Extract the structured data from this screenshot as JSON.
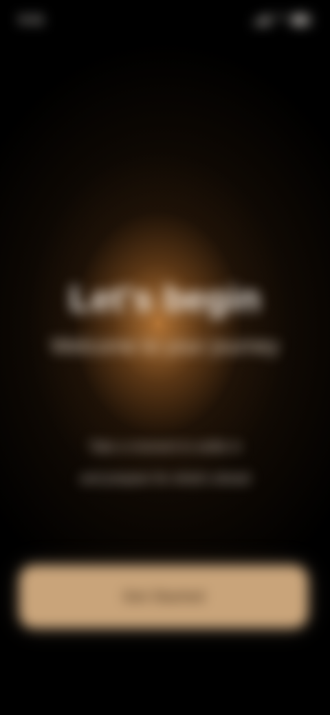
{
  "status_bar": {
    "time": "9:41",
    "icons": [
      "signal-icon",
      "wifi-icon",
      "battery-icon"
    ]
  },
  "hero": {
    "title": "Let's begin",
    "subtitle": "Welcome to your journey"
  },
  "description": {
    "line_1": "Take a moment to settle in",
    "line_2": "and prepare for what's ahead"
  },
  "cta": {
    "label": "Get Started"
  },
  "colors": {
    "background": "#000000",
    "glow": "#b97837",
    "button": "#c9a47a",
    "text": "#f4eee7"
  }
}
